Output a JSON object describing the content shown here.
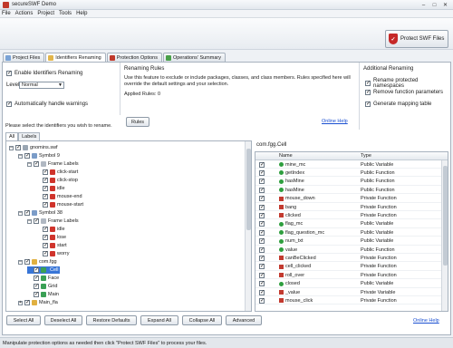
{
  "window": {
    "title": "secureSWF Demo",
    "minimize": "–",
    "maximize": "□",
    "close": "✕"
  },
  "menu": [
    "File",
    "Actions",
    "Project",
    "Tools",
    "Help"
  ],
  "toolbar": {
    "protect_label": "Protect SWF Files",
    "protect_icon": "shield-icon"
  },
  "tabs": [
    {
      "label": "Project Files",
      "color": "#7aa3d6"
    },
    {
      "label": "Identifiers Renaming",
      "color": "#e2b54a"
    },
    {
      "label": "Protection Options",
      "color": "#c0392b"
    },
    {
      "label": "Operations' Summary",
      "color": "#4aa04a"
    }
  ],
  "settings": {
    "enable_renaming": "Enable Identifiers Renaming",
    "level_label": "Level:",
    "level_value": "Normal",
    "auto_warnings": "Automatically handle warnings"
  },
  "renaming_rules": {
    "title": "Renaming Rules",
    "description": "Use this feature to exclude or include packages, classes, and class members. Rules specified here will override the default settings and your selection.",
    "applied": "Applied Rules: 0",
    "rules_button": "Rules",
    "online_help": "Online Help"
  },
  "additional": {
    "title": "Additional Renaming",
    "items": [
      "Rename protected namespaces",
      "Remove function parameters",
      "Generate mapping table"
    ]
  },
  "select_prompt": "Please select the identifiers you wish to rename.",
  "subtabs": [
    "All",
    "Labels"
  ],
  "tree": [
    {
      "label": "gnomins.swf",
      "indent": 0,
      "toggle": "–",
      "checked": true,
      "icon": "#9aa6b3"
    },
    {
      "label": "Symbol 9",
      "indent": 1,
      "toggle": "–",
      "checked": true,
      "icon": "#7b9cc8"
    },
    {
      "label": "Frame Labels",
      "indent": 2,
      "toggle": "–",
      "checked": true,
      "icon": "#b0b8c2"
    },
    {
      "label": "click-start",
      "indent": 3,
      "toggle": "",
      "checked": true,
      "icon": "#d0342c"
    },
    {
      "label": "click-stop",
      "indent": 3,
      "toggle": "",
      "checked": true,
      "icon": "#d0342c"
    },
    {
      "label": "idle",
      "indent": 3,
      "toggle": "",
      "checked": true,
      "icon": "#d0342c"
    },
    {
      "label": "mouse-end",
      "indent": 3,
      "toggle": "",
      "checked": true,
      "icon": "#d0342c"
    },
    {
      "label": "mouse-start",
      "indent": 3,
      "toggle": "",
      "checked": true,
      "icon": "#d0342c"
    },
    {
      "label": "Symbol 38",
      "indent": 1,
      "toggle": "–",
      "checked": true,
      "icon": "#7b9cc8"
    },
    {
      "label": "Frame Labels",
      "indent": 2,
      "toggle": "–",
      "checked": true,
      "icon": "#b0b8c2"
    },
    {
      "label": "idle",
      "indent": 3,
      "toggle": "",
      "checked": true,
      "icon": "#d0342c"
    },
    {
      "label": "lose",
      "indent": 3,
      "toggle": "",
      "checked": true,
      "icon": "#d0342c"
    },
    {
      "label": "start",
      "indent": 3,
      "toggle": "",
      "checked": true,
      "icon": "#d0342c"
    },
    {
      "label": "worry",
      "indent": 3,
      "toggle": "",
      "checked": true,
      "icon": "#d0342c"
    },
    {
      "label": "com.fgg",
      "indent": 1,
      "toggle": "–",
      "checked": true,
      "icon": "#e0b040"
    },
    {
      "label": "Cell",
      "indent": 2,
      "toggle": "",
      "checked": true,
      "icon": "#3aa055",
      "selected": true
    },
    {
      "label": "Face",
      "indent": 2,
      "toggle": "",
      "checked": true,
      "icon": "#3aa055"
    },
    {
      "label": "Grid",
      "indent": 2,
      "toggle": "",
      "checked": true,
      "icon": "#3aa055"
    },
    {
      "label": "Main",
      "indent": 2,
      "toggle": "",
      "checked": true,
      "icon": "#3aa055"
    },
    {
      "label": "Main_fla",
      "indent": 1,
      "toggle": "+",
      "checked": true,
      "icon": "#e0b040"
    }
  ],
  "table": {
    "title": "com.fgg.Cell",
    "columns": [
      "Name",
      "Type"
    ],
    "rows": [
      {
        "name": "mine_mc",
        "type": "Public Variable",
        "color": "#2e9e3e",
        "shape": "dot"
      },
      {
        "name": "getIndex",
        "type": "Public Function",
        "color": "#2e9e3e",
        "shape": "dot"
      },
      {
        "name": "hasMine",
        "type": "Public Function",
        "color": "#2e9e3e",
        "shape": "dot"
      },
      {
        "name": "hasMine",
        "type": "Public Function",
        "color": "#2e9e3e",
        "shape": "dot"
      },
      {
        "name": "mouse_down",
        "type": "Private Function",
        "color": "#c23a2f",
        "shape": "sq"
      },
      {
        "name": "bang",
        "type": "Private Function",
        "color": "#c23a2f",
        "shape": "sq"
      },
      {
        "name": "clicked",
        "type": "Private Function",
        "color": "#c23a2f",
        "shape": "sq"
      },
      {
        "name": "flag_mc",
        "type": "Public Variable",
        "color": "#2e9e3e",
        "shape": "dot"
      },
      {
        "name": "flag_question_mc",
        "type": "Public Variable",
        "color": "#2e9e3e",
        "shape": "dot"
      },
      {
        "name": "num_txt",
        "type": "Public Variable",
        "color": "#2e9e3e",
        "shape": "dot"
      },
      {
        "name": "value",
        "type": "Public Function",
        "color": "#2e9e3e",
        "shape": "dot"
      },
      {
        "name": "canBeClicked",
        "type": "Private Function",
        "color": "#c23a2f",
        "shape": "sq"
      },
      {
        "name": "cell_clicked",
        "type": "Private Function",
        "color": "#c23a2f",
        "shape": "sq"
      },
      {
        "name": "roll_over",
        "type": "Private Function",
        "color": "#c23a2f",
        "shape": "sq"
      },
      {
        "name": "closed",
        "type": "Public Variable",
        "color": "#2e9e3e",
        "shape": "dot"
      },
      {
        "name": "_value",
        "type": "Private Variable",
        "color": "#c23a2f",
        "shape": "sq"
      },
      {
        "name": "mouse_click",
        "type": "Private Function",
        "color": "#c23a2f",
        "shape": "sq"
      }
    ]
  },
  "bottom_buttons": [
    "Select All",
    "Deselect All",
    "Restore Defaults",
    "Expand All",
    "Collapse All",
    "Advanced"
  ],
  "bottom_help": "Online Help",
  "status": "Manipulate protection options as needed then click \"Protect SWF Files\" to process your files."
}
